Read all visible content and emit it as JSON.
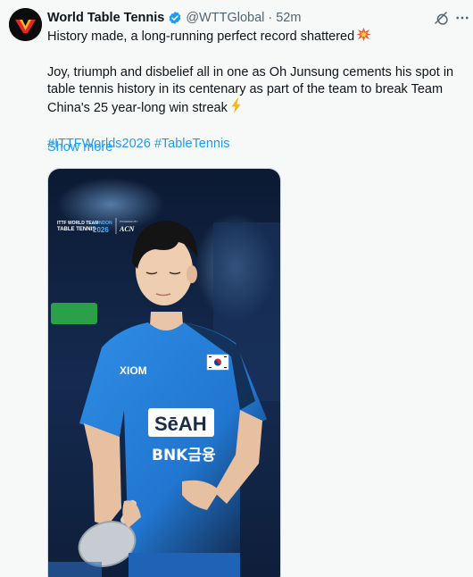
{
  "tweet": {
    "author_name": "World Table Tennis",
    "handle": "@WTTGlobal",
    "separator": "·",
    "time": "52m",
    "text_line1": "History made, a long-running perfect record shattered",
    "text_line1_emoji": "collision-emoji",
    "text_para2": [
      "Joy, triumph and disbelief all in one as Oh Junsung cements his spot in",
      "table tennis history in its centenary as part of the team to break Team",
      "China's 25 year-long win streak"
    ],
    "text_para2_emoji": "high-voltage-emoji",
    "hashtags": [
      "#ITTFWorlds2026",
      "#TableTennis"
    ],
    "show_more": "Show more"
  },
  "media": {
    "event_logo_line1": "ITTF WORLD TEAM",
    "event_logo_line2": "TABLE TENNIS",
    "event_logo_city": "LONDON",
    "event_logo_year": "2026",
    "sponsor_prefix": "POWERED BY",
    "sponsor": "ACN",
    "shirt_brand": "XIOM",
    "shirt_sponsor1": "SēAH",
    "shirt_sponsor2": "BNK금융",
    "flag": "south-korea-flag",
    "description_hidden": ""
  },
  "icons": {
    "verified": "verified-badge-icon",
    "grok": "grok-icon",
    "more": "more-icon",
    "avatar": "wtt-logo"
  },
  "colors": {
    "background": "#f7f9f9",
    "link": "#1d9bf0",
    "secondary_text": "#536471",
    "verified_blue": "#1d9bf0",
    "wtt_red": "#e3262b",
    "wtt_yellow": "#f7b51c",
    "jersey_blue": "#2f8de4"
  }
}
